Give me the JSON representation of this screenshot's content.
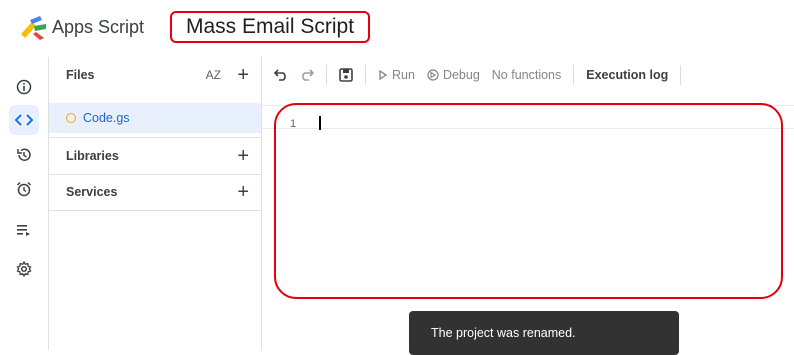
{
  "header": {
    "app_name": "Apps Script",
    "project_title": "Mass Email Script"
  },
  "rail": {
    "items": [
      {
        "icon": "info-icon",
        "active": false
      },
      {
        "icon": "code-icon",
        "active": true
      },
      {
        "icon": "history-icon",
        "active": false
      },
      {
        "icon": "alarm-icon",
        "active": false
      },
      {
        "icon": "executions-icon",
        "active": false
      },
      {
        "icon": "settings-icon",
        "active": false
      }
    ]
  },
  "files_panel": {
    "files_label": "Files",
    "sort_label": "AZ",
    "file_name": "Code.gs",
    "libraries_label": "Libraries",
    "services_label": "Services"
  },
  "toolbar": {
    "run_label": "Run",
    "debug_label": "Debug",
    "function_select": "No functions",
    "execution_log_label": "Execution log"
  },
  "editor": {
    "line_number": "1"
  },
  "toast": {
    "message": "The project was renamed."
  },
  "colors": {
    "highlight": "#e3000f",
    "accent": "#1a73e8",
    "active_bg": "#e8f0fe",
    "toast_bg": "#323232"
  }
}
